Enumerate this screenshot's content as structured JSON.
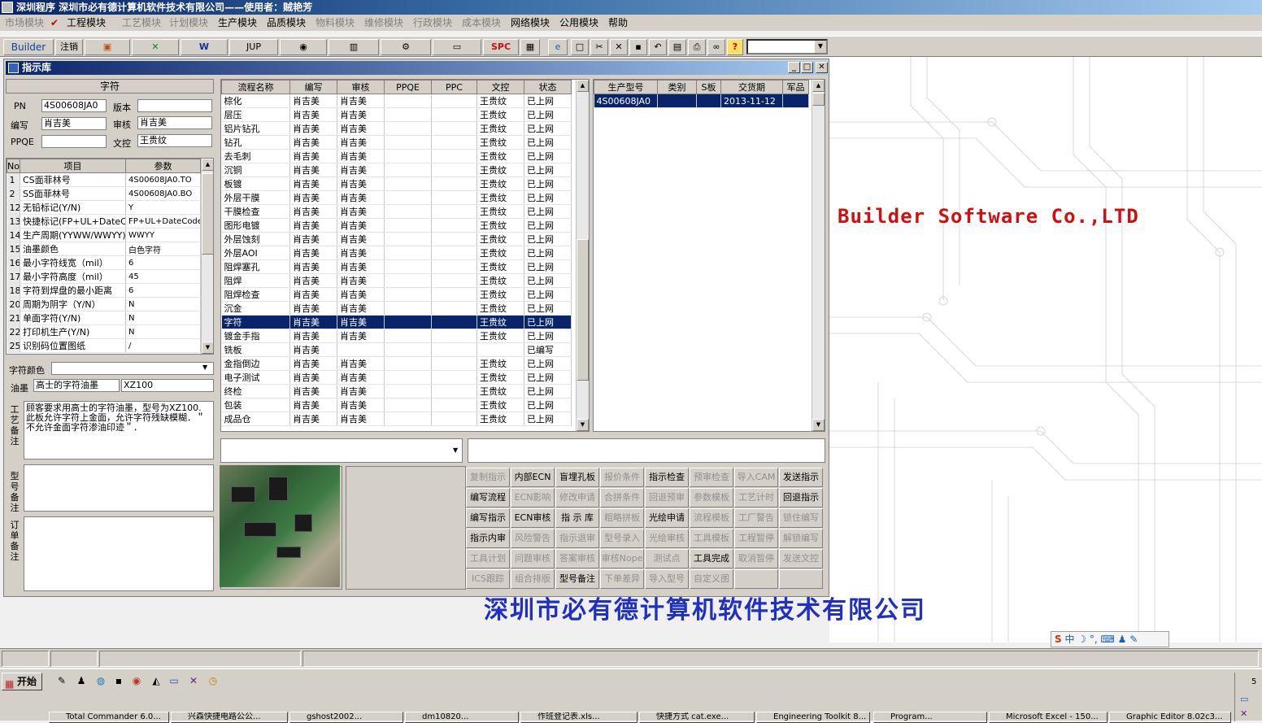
{
  "app": {
    "title": "深圳程序   深圳市必有德计算机软件技术有限公司——使用者：贼艳芳"
  },
  "menu": [
    "市场模块",
    "工程模块",
    "工艺模块",
    "计划模块",
    "生产模块",
    "品质模块",
    "物料模块",
    "维修模块",
    "行政模块",
    "成本模块",
    "网络模块",
    "公用模块",
    "帮助"
  ],
  "toolbar": {
    "builder": "Builder",
    "logout": "注销",
    "jup": "JUP",
    "spc": "SPC",
    "help": "?",
    "combo": ""
  },
  "window": {
    "title": "指示库"
  },
  "left": {
    "section_title": "字符",
    "pn_label": "PN",
    "pn_value": "4S00608JA0",
    "version_label": "版本",
    "version_value": "",
    "editor_label": "编写",
    "editor_value": "肖吉美",
    "reviewer_label": "审核",
    "reviewer_value": "肖吉美",
    "ppqe_label": "PPQE",
    "ppqe_value": "",
    "doc_label": "文控",
    "doc_value": "王贵纹",
    "param_headers": [
      "No",
      "项目",
      "参数"
    ],
    "params": [
      [
        "1",
        "CS面菲林号",
        "4S00608JA0.TO"
      ],
      [
        "2",
        "SS面菲林号",
        "4S00608JA0.BO"
      ],
      [
        "12",
        "无铅标记(Y/N)",
        "Y"
      ],
      [
        "13",
        "快捷标记(FP+UL+DateCo",
        "FP+UL+DateCode"
      ],
      [
        "14",
        "生产周期(YYWW/WWYY)",
        "WWYY"
      ],
      [
        "15",
        "油墨颜色",
        "白色字符"
      ],
      [
        "16",
        "最小字符线宽（mil）",
        "6"
      ],
      [
        "17",
        "最小字符高度（mil）",
        "45"
      ],
      [
        "18",
        "字符到焊盘的最小距离",
        "6"
      ],
      [
        "20",
        "周期为阴字（Y/N）",
        "N"
      ],
      [
        "21",
        "单面字符(Y/N)",
        "N"
      ],
      [
        "22",
        "打印机生产(Y/N)",
        "N"
      ],
      [
        "25",
        "识别码位置图纸",
        "/"
      ]
    ],
    "char_color_label": "字符颜色",
    "char_color_value": "",
    "ink_label": "油墨",
    "ink_name": "高士的字符油墨",
    "ink_model": "XZ100",
    "process_note_label": "工艺备注",
    "process_note": "顾客要求用高士的字符油墨，型号为XZ100.\n此板允许字符上金面，允许字符残缺模糊．＂不允许金面字符渗油印迹＂．",
    "model_note_label": "型号备注",
    "model_note": "",
    "order_note_label": "订单备注",
    "order_note": ""
  },
  "flow": {
    "headers": [
      "流程名称",
      "编写",
      "审核",
      "PPQE",
      "PPC",
      "文控",
      "状态"
    ],
    "rows": [
      [
        "棕化",
        "肖吉美",
        "肖吉美",
        "",
        "",
        "王贵纹",
        "已上网"
      ],
      [
        "层压",
        "肖吉美",
        "肖吉美",
        "",
        "",
        "王贵纹",
        "已上网"
      ],
      [
        "铝片钻孔",
        "肖吉美",
        "肖吉美",
        "",
        "",
        "王贵纹",
        "已上网"
      ],
      [
        "钻孔",
        "肖吉美",
        "肖吉美",
        "",
        "",
        "王贵纹",
        "已上网"
      ],
      [
        "去毛刺",
        "肖吉美",
        "肖吉美",
        "",
        "",
        "王贵纹",
        "已上网"
      ],
      [
        "沉铜",
        "肖吉美",
        "肖吉美",
        "",
        "",
        "王贵纹",
        "已上网"
      ],
      [
        "板镀",
        "肖吉美",
        "肖吉美",
        "",
        "",
        "王贵纹",
        "已上网"
      ],
      [
        "外层干膜",
        "肖吉美",
        "肖吉美",
        "",
        "",
        "王贵纹",
        "已上网"
      ],
      [
        "干膜检查",
        "肖吉美",
        "肖吉美",
        "",
        "",
        "王贵纹",
        "已上网"
      ],
      [
        "图形电镀",
        "肖吉美",
        "肖吉美",
        "",
        "",
        "王贵纹",
        "已上网"
      ],
      [
        "外层蚀刻",
        "肖吉美",
        "肖吉美",
        "",
        "",
        "王贵纹",
        "已上网"
      ],
      [
        "外层AOI",
        "肖吉美",
        "肖吉美",
        "",
        "",
        "王贵纹",
        "已上网"
      ],
      [
        "阻焊塞孔",
        "肖吉美",
        "肖吉美",
        "",
        "",
        "王贵纹",
        "已上网"
      ],
      [
        "阻焊",
        "肖吉美",
        "肖吉美",
        "",
        "",
        "王贵纹",
        "已上网"
      ],
      [
        "阻焊检查",
        "肖吉美",
        "肖吉美",
        "",
        "",
        "王贵纹",
        "已上网"
      ],
      [
        "沉金",
        "肖吉美",
        "肖吉美",
        "",
        "",
        "王贵纹",
        "已上网"
      ],
      [
        "字符",
        "肖吉美",
        "肖吉美",
        "",
        "",
        "王贵纹",
        "已上网"
      ],
      [
        "镀金手指",
        "肖吉美",
        "肖吉美",
        "",
        "",
        "王贵纹",
        "已上网"
      ],
      [
        "铣板",
        "肖吉美",
        "",
        "",
        "",
        "",
        "已编写"
      ],
      [
        "金指倒边",
        "肖吉美",
        "肖吉美",
        "",
        "",
        "王贵纹",
        "已上网"
      ],
      [
        "电子测试",
        "肖吉美",
        "肖吉美",
        "",
        "",
        "王贵纹",
        "已上网"
      ],
      [
        "终检",
        "肖吉美",
        "肖吉美",
        "",
        "",
        "王贵纹",
        "已上网"
      ],
      [
        "包装",
        "肖吉美",
        "肖吉美",
        "",
        "",
        "王贵纹",
        "已上网"
      ],
      [
        "成品仓",
        "肖吉美",
        "肖吉美",
        "",
        "",
        "王贵纹",
        "已上网"
      ]
    ],
    "selected_index": 16
  },
  "model": {
    "headers": [
      "生产型号",
      "类别",
      "S板",
      "交货期",
      "军品"
    ],
    "rows": [
      [
        "4S00608JA0",
        "",
        "",
        "2013-11-12",
        ""
      ]
    ]
  },
  "buttons": [
    {
      "label": "复制指示",
      "enabled": false
    },
    {
      "label": "内部ECN",
      "enabled": true
    },
    {
      "label": "盲埋孔板",
      "enabled": true
    },
    {
      "label": "报价条件",
      "enabled": false
    },
    {
      "label": "指示检查",
      "enabled": true
    },
    {
      "label": "预审检查",
      "enabled": false
    },
    {
      "label": "导入CAM",
      "enabled": false
    },
    {
      "label": "发送指示",
      "enabled": true
    },
    {
      "label": "编写流程",
      "enabled": true
    },
    {
      "label": "ECN影响",
      "enabled": false
    },
    {
      "label": "修改申请",
      "enabled": false
    },
    {
      "label": "合拼条件",
      "enabled": false
    },
    {
      "label": "回退预审",
      "enabled": false
    },
    {
      "label": "参数模板",
      "enabled": false
    },
    {
      "label": "工艺计时",
      "enabled": false
    },
    {
      "label": "回退指示",
      "enabled": true
    },
    {
      "label": "编写指示",
      "enabled": true
    },
    {
      "label": "ECN审核",
      "enabled": true
    },
    {
      "label": "指 示 库",
      "enabled": true
    },
    {
      "label": "粗略拼板",
      "enabled": false
    },
    {
      "label": "光绘申请",
      "enabled": true
    },
    {
      "label": "流程模板",
      "enabled": false
    },
    {
      "label": "工厂警告",
      "enabled": false
    },
    {
      "label": "锁住编写",
      "enabled": false
    },
    {
      "label": "指示内审",
      "enabled": true
    },
    {
      "label": "风险警告",
      "enabled": false
    },
    {
      "label": "指示退审",
      "enabled": false
    },
    {
      "label": "型号录入",
      "enabled": false
    },
    {
      "label": "光绘审核",
      "enabled": false
    },
    {
      "label": "工具模板",
      "enabled": false
    },
    {
      "label": "工程暂停",
      "enabled": false
    },
    {
      "label": "解锁编写",
      "enabled": false
    },
    {
      "label": "工具计划",
      "enabled": false
    },
    {
      "label": "问题审核",
      "enabled": false
    },
    {
      "label": "答案审核",
      "enabled": false
    },
    {
      "label": "审核Nope",
      "enabled": false
    },
    {
      "label": "测试点",
      "enabled": false
    },
    {
      "label": "工具完成",
      "enabled": true
    },
    {
      "label": "取消暂停",
      "enabled": false
    },
    {
      "label": "发送文控",
      "enabled": false
    },
    {
      "label": "ICS跟踪",
      "enabled": false
    },
    {
      "label": "组合排版",
      "enabled": false
    },
    {
      "label": "型号备注",
      "enabled": true
    },
    {
      "label": "下单差异",
      "enabled": false
    },
    {
      "label": "导入型号",
      "enabled": false
    },
    {
      "label": "自定义图",
      "enabled": false
    },
    {
      "label": "",
      "enabled": false
    },
    {
      "label": "",
      "enabled": false
    }
  ],
  "desktop": {
    "company_en": "Builder Software Co.,LTD",
    "company_cn": "深圳市必有德计算机软件技术有限公司"
  },
  "ime": {
    "text": "中 ☽ °, ⌨ ♟ ✎"
  },
  "taskbar": {
    "start": "开始",
    "tasks": [
      "Total Commander 6.0...",
      "兴森快捷电路公公...",
      "gshost2002...",
      "dm10820...",
      "作班登记表.xls...",
      "快捷方式 cat.exe...",
      "Engineering Toolkit 8...",
      "Program...",
      "Microsoft Excel - 150...",
      "Graphic Editor 8.02c3..."
    ]
  },
  "colors": {
    "selection": "#0a246a",
    "brand_red": "#d01010",
    "brand_blue": "#2030c0",
    "face": "#d4d0c8"
  }
}
